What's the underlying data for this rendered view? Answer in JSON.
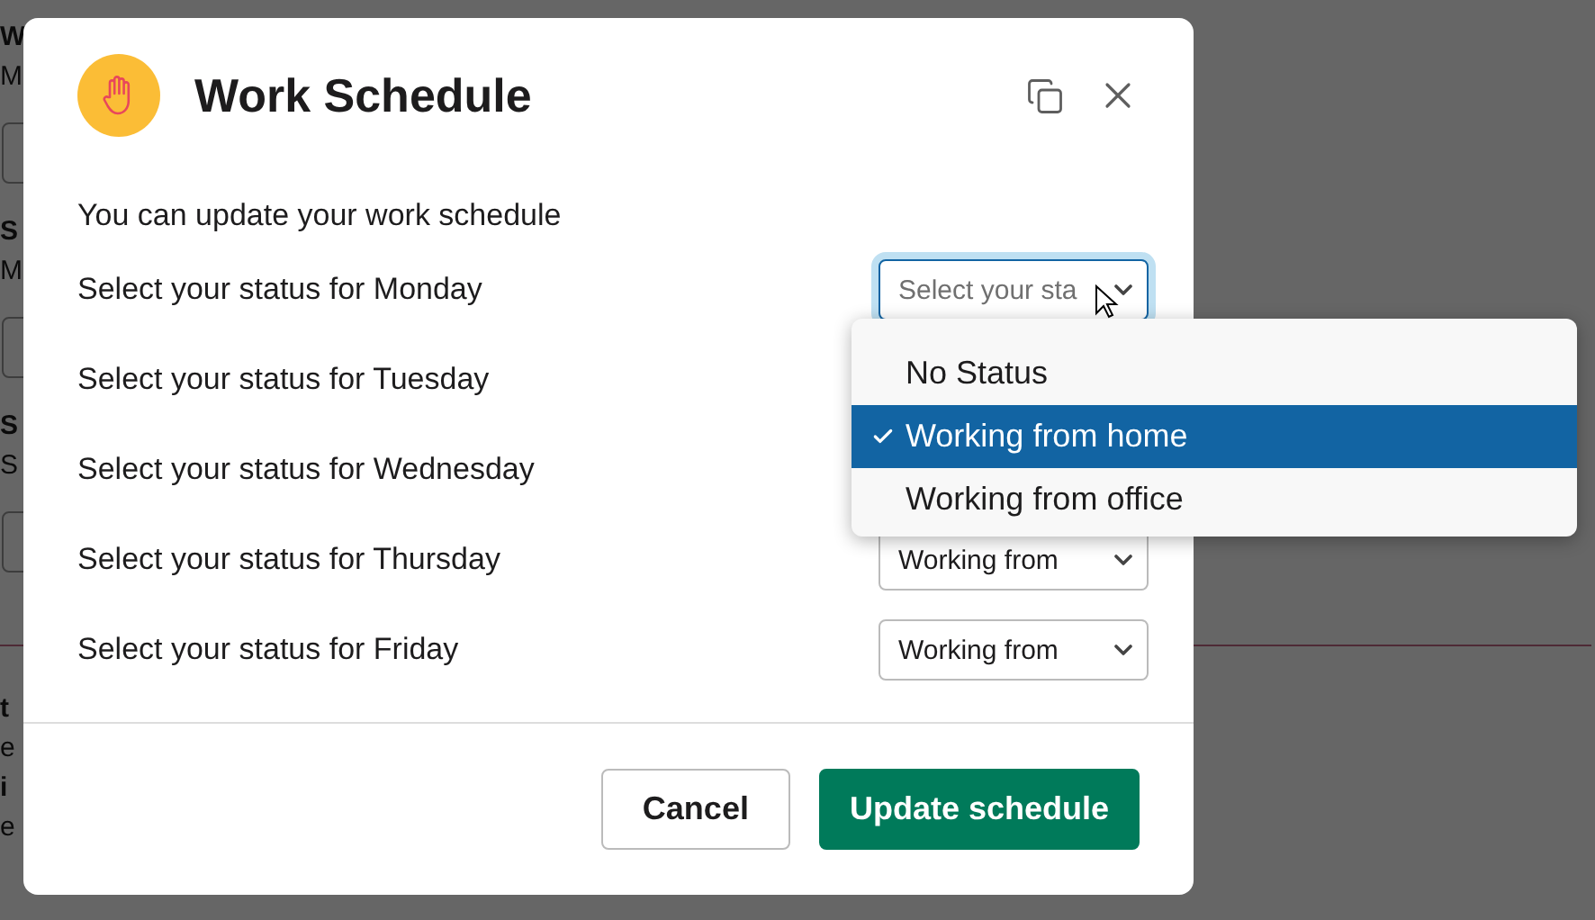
{
  "background": {
    "items": [
      {
        "kind": "heading",
        "text": "W"
      },
      {
        "kind": "text",
        "text": "M"
      },
      {
        "kind": "field"
      },
      {
        "kind": "heading",
        "text": "S"
      },
      {
        "kind": "text",
        "text": "M"
      },
      {
        "kind": "field"
      },
      {
        "kind": "heading",
        "text": "S"
      },
      {
        "kind": "text",
        "text": "S"
      },
      {
        "kind": "field"
      },
      {
        "kind": "rule"
      },
      {
        "kind": "heading",
        "text": "t"
      },
      {
        "kind": "text",
        "text": "e"
      },
      {
        "kind": "heading",
        "text": "i"
      },
      {
        "kind": "text",
        "text": "e"
      }
    ]
  },
  "dialog": {
    "title": "Work Schedule",
    "intro": "You can update your work schedule",
    "days": [
      {
        "label": "Select your status for Monday",
        "select": {
          "placeholder": "Select your sta",
          "focused": true
        }
      },
      {
        "label": "Select your status for Tuesday"
      },
      {
        "label": "Select your status for Wednesday"
      },
      {
        "label": "Select your status for Thursday",
        "select": {
          "value": "Working from",
          "focused": false
        }
      },
      {
        "label": "Select your status for Friday",
        "select": {
          "value": "Working from",
          "focused": false
        }
      }
    ],
    "dropdown": {
      "options": [
        {
          "label": "No Status",
          "selected": false
        },
        {
          "label": "Working from home",
          "selected": true
        },
        {
          "label": "Working from office",
          "selected": false
        }
      ]
    },
    "buttons": [
      {
        "label": "Cancel",
        "kind": "secondary"
      },
      {
        "label": "Update schedule",
        "kind": "primary"
      }
    ]
  }
}
